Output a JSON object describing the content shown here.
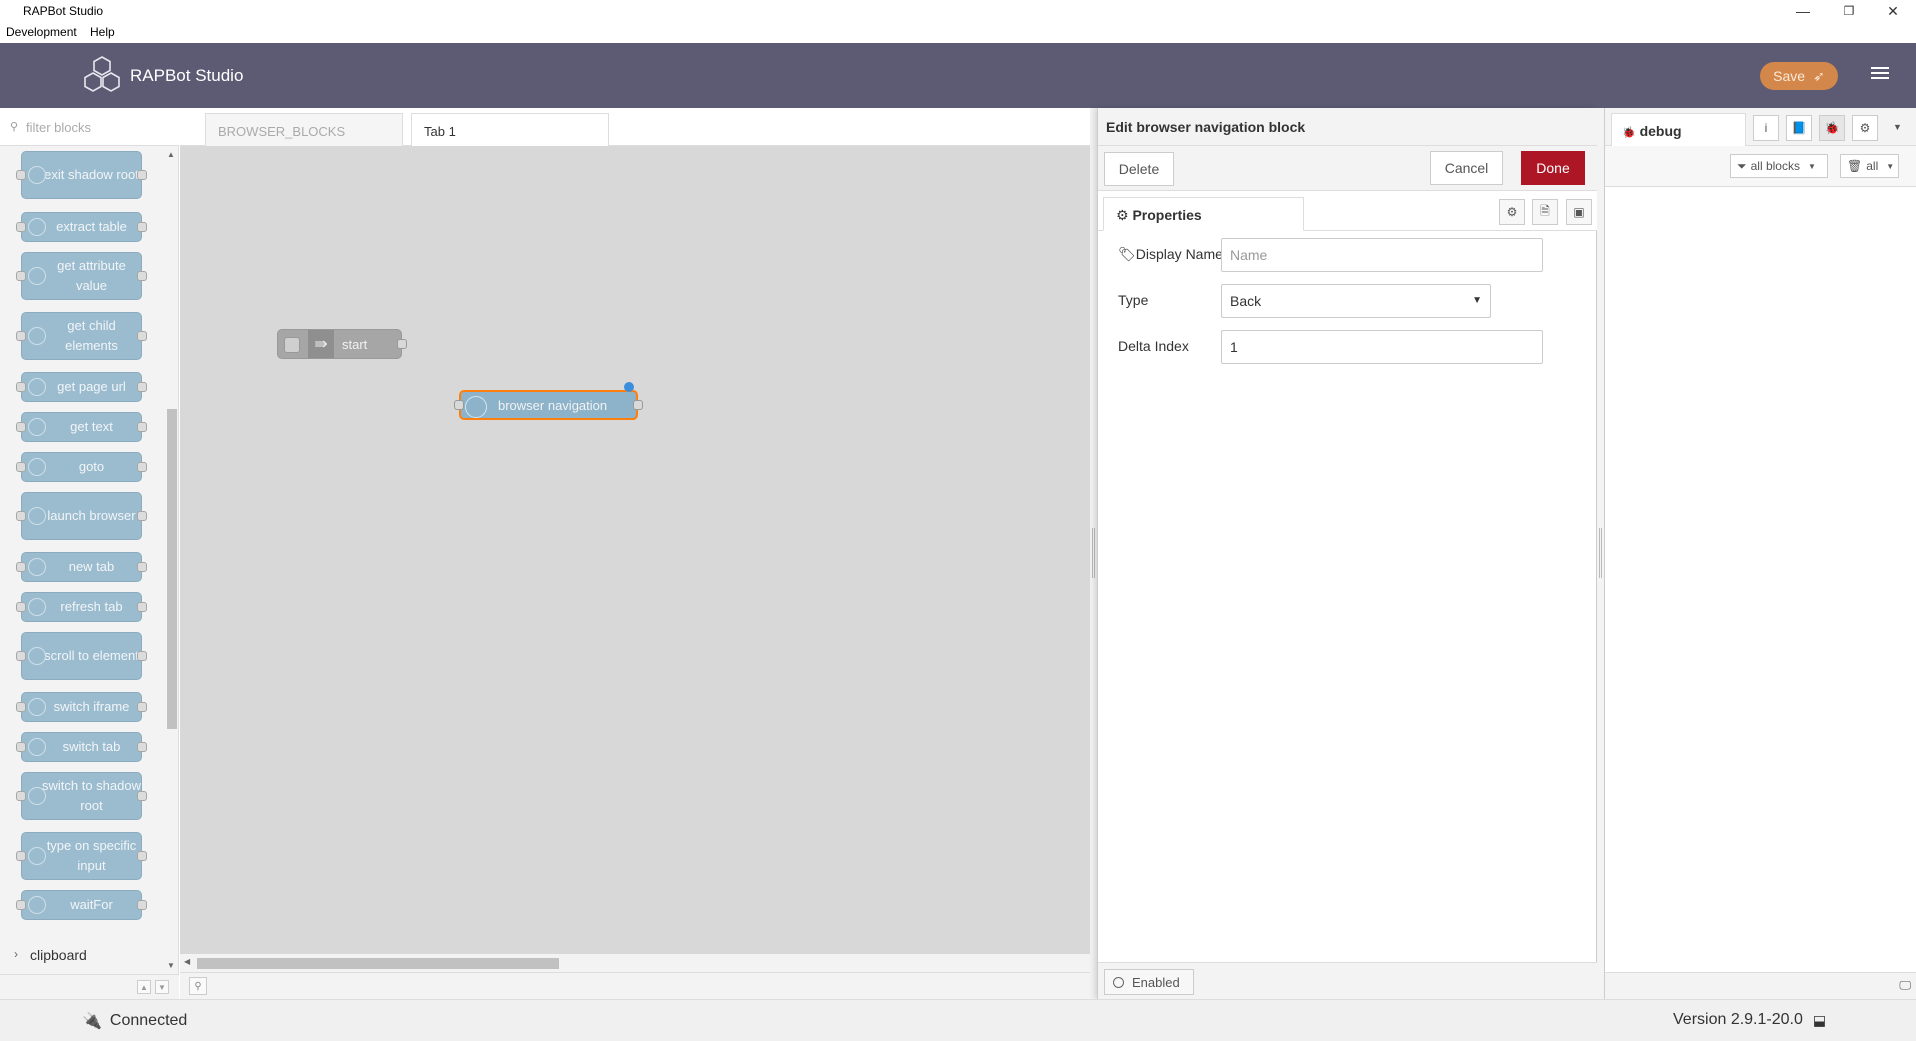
{
  "window": {
    "title": "RAPBot Studio",
    "minimize": "—",
    "maximize": "❐",
    "close": "✕"
  },
  "menu": {
    "items": [
      "Development",
      "Help"
    ]
  },
  "header": {
    "app_name": "RAPBot Studio",
    "save_label": "Save"
  },
  "palette": {
    "filter_placeholder": "filter blocks",
    "nodes": [
      {
        "label": "exit shadow root"
      },
      {
        "label": "extract table"
      },
      {
        "label": "get attribute value"
      },
      {
        "label": "get child elements"
      },
      {
        "label": "get page url"
      },
      {
        "label": "get text"
      },
      {
        "label": "goto"
      },
      {
        "label": "launch browser"
      },
      {
        "label": "new tab"
      },
      {
        "label": "refresh tab"
      },
      {
        "label": "scroll to element"
      },
      {
        "label": "switch iframe"
      },
      {
        "label": "switch tab"
      },
      {
        "label": "switch to shadow root"
      },
      {
        "label": "type on specific input"
      },
      {
        "label": "waitFor"
      }
    ],
    "category": "clipboard"
  },
  "workspace": {
    "tabs": [
      {
        "label": "BROWSER_BLOCKS"
      },
      {
        "label": "Tab 1"
      }
    ],
    "nodes": {
      "start": "start",
      "browser_navigation": "browser navigation"
    }
  },
  "editor": {
    "title": "Edit browser navigation block",
    "delete_label": "Delete",
    "cancel_label": "Cancel",
    "done_label": "Done",
    "properties_tab": "Properties",
    "fields": {
      "display_name_label": "Display Name",
      "display_name_placeholder": "Name",
      "type_label": "Type",
      "type_value": "Back",
      "delta_index_label": "Delta Index",
      "delta_index_value": "1"
    },
    "enabled_label": "Enabled"
  },
  "sidebar": {
    "tab_label": "debug",
    "filter_label": "all blocks",
    "clear_label": "all"
  },
  "status": {
    "connection": "Connected",
    "version": "Version 2.9.1-20.0"
  },
  "colors": {
    "header": "#5d5b74",
    "save": "#d3874b",
    "done": "#ad1625",
    "palette_node": "#8cb3c9"
  }
}
